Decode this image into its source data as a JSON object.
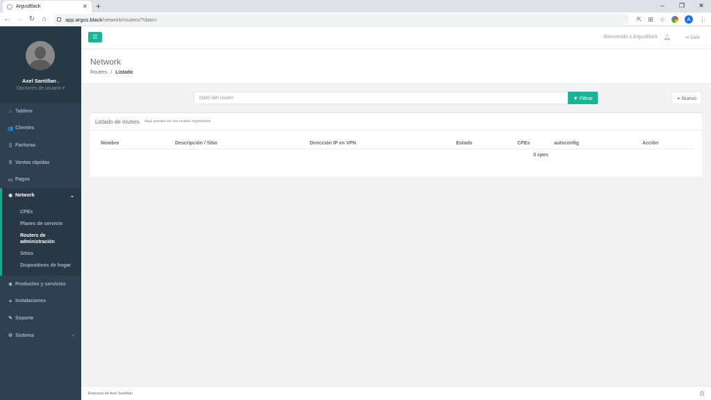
{
  "browser": {
    "tab_title": "ArgusBlack",
    "tab_close": "✕",
    "new_tab": "+",
    "url_host": "app.argus.black",
    "url_path": "/network/routers/?dato="
  },
  "sidebar": {
    "user_name": "Axel Santillan .",
    "user_options": "Opciones de usuario ▾",
    "items": [
      {
        "label": "Tablero",
        "icon": "⌂"
      },
      {
        "label": "Clientes",
        "icon": "👥"
      },
      {
        "label": "Facturas",
        "icon": "▯"
      },
      {
        "label": "Ventas rápidas",
        "icon": "$"
      },
      {
        "label": "Pagos",
        "icon": "▭"
      },
      {
        "label": "Network",
        "icon": "✱"
      },
      {
        "label": "Productos y servicios",
        "icon": "◆"
      },
      {
        "label": "Instalaciones",
        "icon": "✦"
      },
      {
        "label": "Soporte",
        "icon": "✎"
      },
      {
        "label": "Sistema",
        "icon": "⚙"
      }
    ],
    "network_sub": [
      "CPEs",
      "Planes de servicio",
      "Routers de administración",
      "Sitios",
      "Dispositivos de hogar"
    ]
  },
  "topbar": {
    "welcome": "Bienvenido a ArgusBlack",
    "logout": "Salir"
  },
  "heading": {
    "title": "Network",
    "breadcrumb_parent": "Routers",
    "breadcrumb_sep": "/",
    "breadcrumb_current": "Listado"
  },
  "search": {
    "placeholder": "Dato del router",
    "filter_label": "Filtrar",
    "new_label": "Nuevo"
  },
  "panel": {
    "title": "Listado de routers",
    "subtitle": "Aqui puedes ver los routers registrados",
    "columns": [
      "Nombre",
      "Descripción / Sitio",
      "Dirección IP en VPN",
      "Estado",
      "CPEs",
      "autoconfig",
      "Acción"
    ],
    "empty_text": "0 cpes"
  },
  "footer": {
    "text": "Empresa de Axel Santillan"
  },
  "colors": {
    "accent": "#1ab394",
    "sidebar": "#2f4050"
  }
}
